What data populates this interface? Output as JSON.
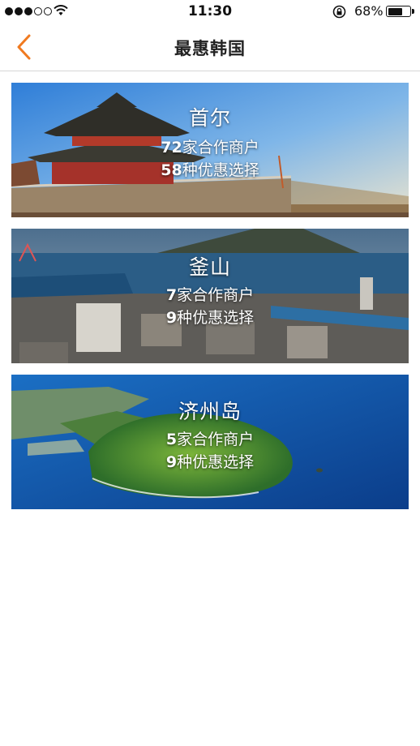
{
  "status_bar": {
    "time": "11:30",
    "battery_percent": "68%",
    "battery_level": 0.68,
    "signal_strength": 3,
    "signal_max": 5
  },
  "nav": {
    "title": "最惠韩国",
    "back_icon": "chevron-left-icon",
    "accent_color": "#f07a20"
  },
  "cities": [
    {
      "name": "首尔",
      "merchants_count": "72",
      "merchants_label": "家合作商户",
      "offers_count": "58",
      "offers_label": "种优惠选择"
    },
    {
      "name": "釜山",
      "merchants_count": "7",
      "merchants_label": "家合作商户",
      "offers_count": "9",
      "offers_label": "种优惠选择"
    },
    {
      "name": "济州岛",
      "merchants_count": "5",
      "merchants_label": "家合作商户",
      "offers_count": "9",
      "offers_label": "种优惠选择"
    }
  ]
}
